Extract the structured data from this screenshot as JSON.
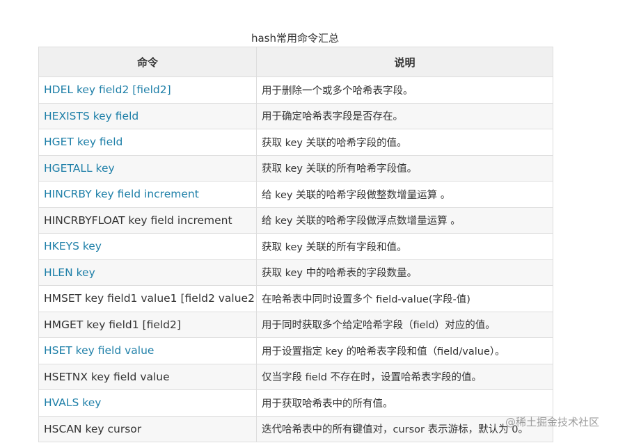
{
  "caption": "hash常用命令汇总",
  "table": {
    "headers": [
      "命令",
      "说明"
    ],
    "rows": [
      {
        "command": "HDEL key field2 [field2]",
        "link": true,
        "description": "用于删除一个或多个哈希表字段。"
      },
      {
        "command": "HEXISTS key field",
        "link": true,
        "description": "用于确定哈希表字段是否存在。"
      },
      {
        "command": "HGET key field",
        "link": true,
        "description": "获取 key 关联的哈希字段的值。"
      },
      {
        "command": "HGETALL key",
        "link": true,
        "description": "获取 key 关联的所有哈希字段值。"
      },
      {
        "command": "HINCRBY key field increment",
        "link": true,
        "description": "给 key 关联的哈希字段做整数增量运算 。"
      },
      {
        "command": "HINCRBYFLOAT key field increment",
        "link": false,
        "description": "给 key 关联的哈希字段做浮点数增量运算 。"
      },
      {
        "command": "HKEYS key",
        "link": true,
        "description": "获取 key 关联的所有字段和值。"
      },
      {
        "command": "HLEN key",
        "link": true,
        "description": "获取 key 中的哈希表的字段数量。"
      },
      {
        "command": "HMSET key field1 value1 [field2 value2 ]",
        "link": false,
        "description": "在哈希表中同时设置多个 field-value(字段-值)"
      },
      {
        "command": "HMGET key field1 [field2]",
        "link": false,
        "description": "用于同时获取多个给定哈希字段（field）对应的值。"
      },
      {
        "command": "HSET key field value",
        "link": true,
        "description": "用于设置指定 key 的哈希表字段和值（field/value）。"
      },
      {
        "command": "HSETNX key field value",
        "link": false,
        "description": "仅当字段 field 不存在时，设置哈希表字段的值。"
      },
      {
        "command": "HVALS key",
        "link": true,
        "description": "用于获取哈希表中的所有值。"
      },
      {
        "command": "HSCAN key cursor",
        "link": false,
        "description": "迭代哈希表中的所有键值对，cursor 表示游标，默认为 0。"
      }
    ]
  },
  "watermark": "@稀土掘金技术社区",
  "colors": {
    "link": "#1e7fa8",
    "header_bg": "#f0f0f0",
    "border": "#dddddd"
  }
}
